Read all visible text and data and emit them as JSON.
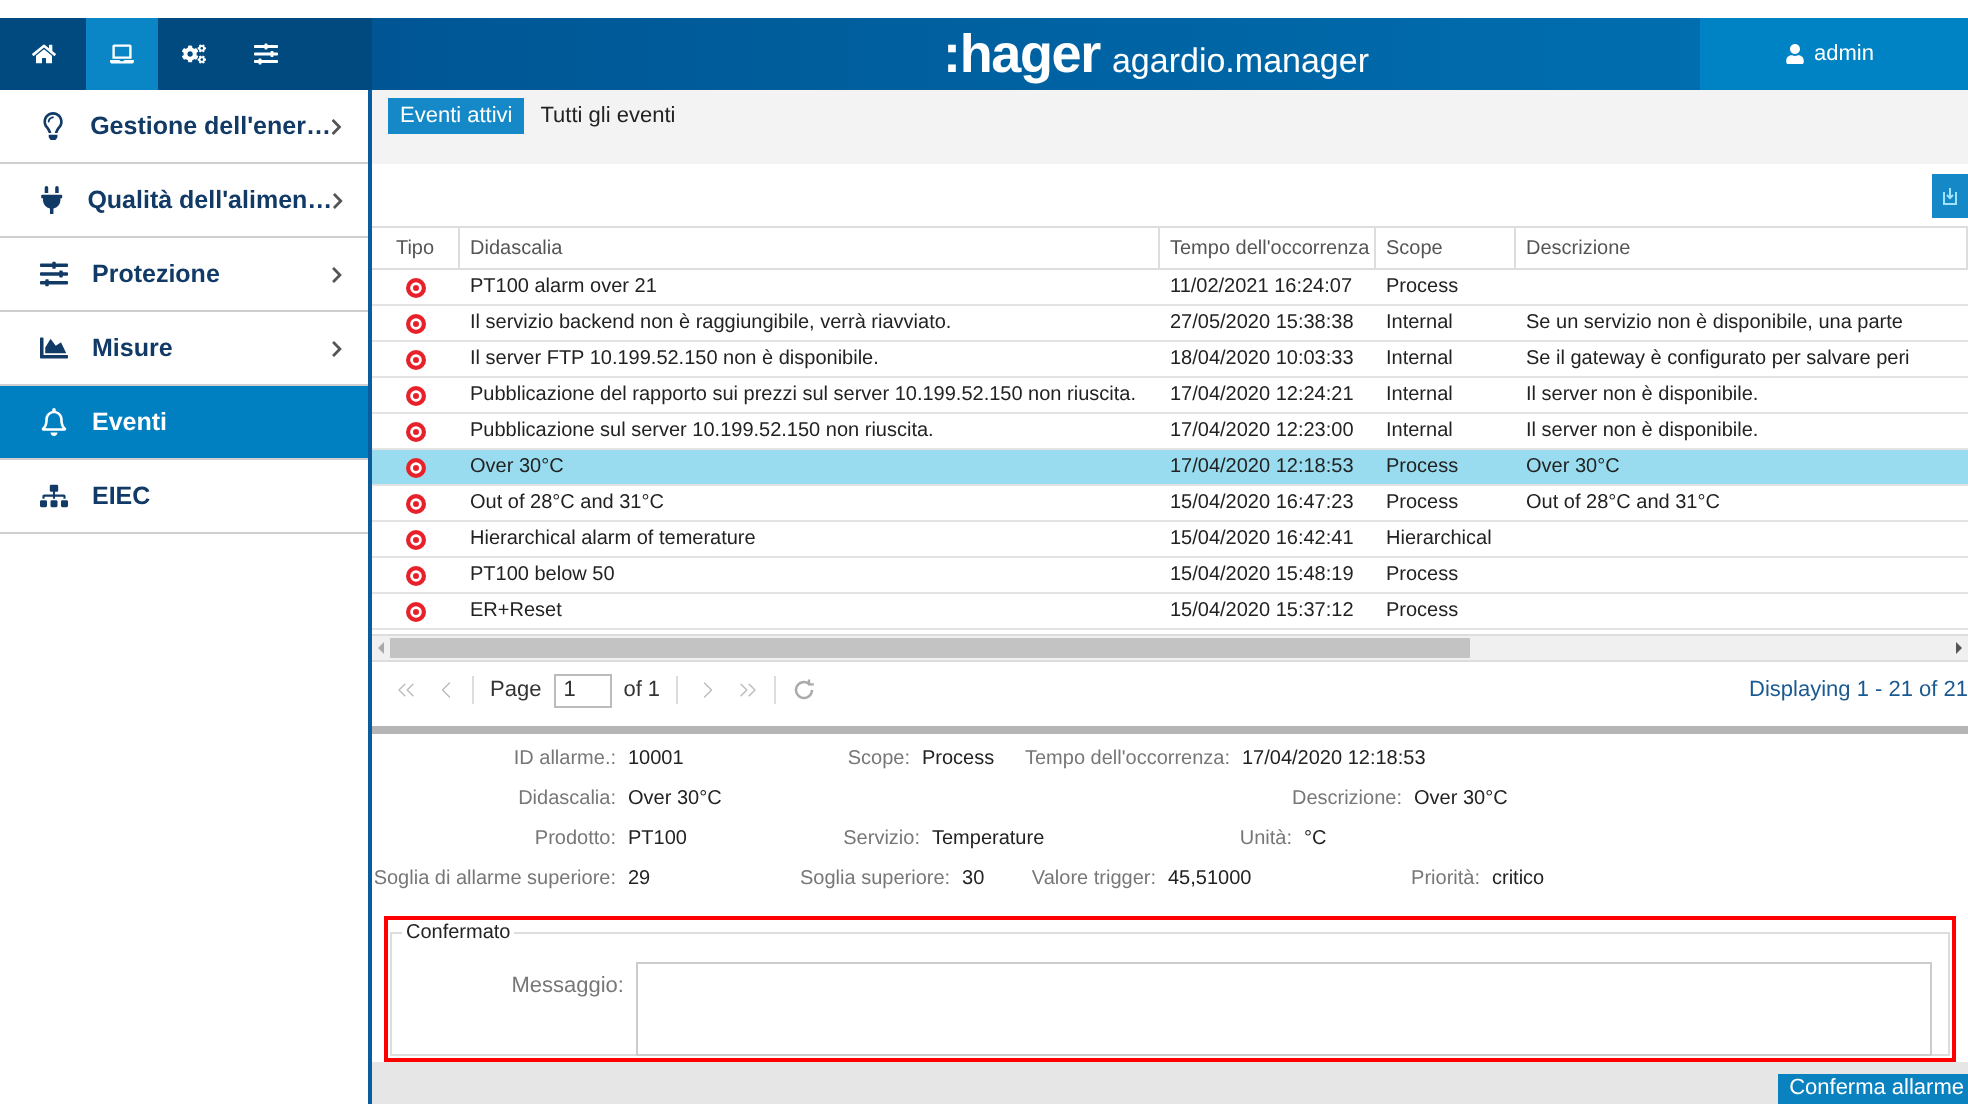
{
  "top_tabs": [
    {
      "selected": false
    },
    {
      "selected": true
    },
    {
      "selected": false
    },
    {
      "selected": false
    }
  ],
  "header": {
    "brand": ":hager",
    "product": "agardio.manager",
    "user": "admin"
  },
  "sidebar": {
    "items": [
      {
        "label": "Gestione dell'ener…",
        "selected": false,
        "has_submenu": true
      },
      {
        "label": "Qualità dell'alimen…",
        "selected": false,
        "has_submenu": true
      },
      {
        "label": "Protezione",
        "selected": false,
        "has_submenu": true
      },
      {
        "label": "Misure",
        "selected": false,
        "has_submenu": true
      },
      {
        "label": "Eventi",
        "selected": true,
        "has_submenu": false
      },
      {
        "label": "EIEC",
        "selected": false,
        "has_submenu": false
      }
    ]
  },
  "tabs": [
    {
      "label": "Eventi attivi",
      "selected": true
    },
    {
      "label": "Tutti gli eventi",
      "selected": false
    }
  ],
  "table": {
    "columns": [
      "Tipo",
      "Didascalia",
      "Tempo dell'occorrenza",
      "Scope",
      "Descrizione"
    ],
    "rows": [
      {
        "caption": "PT100 alarm over 21",
        "time": "11/02/2021 16:24:07",
        "scope": "Process",
        "description": "",
        "selected": false
      },
      {
        "caption": "Il servizio backend non è raggiungibile, verrà riavviato.",
        "time": "27/05/2020 15:38:38",
        "scope": "Internal",
        "description": "Se un servizio non è disponibile, una parte",
        "selected": false
      },
      {
        "caption": "Il server FTP 10.199.52.150 non è disponibile.",
        "time": "18/04/2020 10:03:33",
        "scope": "Internal",
        "description": "Se il gateway è configurato per salvare peri",
        "selected": false
      },
      {
        "caption": "Pubblicazione del rapporto sui prezzi sul server 10.199.52.150 non riuscita.",
        "time": "17/04/2020 12:24:21",
        "scope": "Internal",
        "description": "Il server non è disponibile.",
        "selected": false
      },
      {
        "caption": "Pubblicazione sul server 10.199.52.150 non riuscita.",
        "time": "17/04/2020 12:23:00",
        "scope": "Internal",
        "description": "Il server non è disponibile.",
        "selected": false
      },
      {
        "caption": "Over 30°C",
        "time": "17/04/2020 12:18:53",
        "scope": "Process",
        "description": "Over 30°C",
        "selected": true
      },
      {
        "caption": "Out of 28°C and 31°C",
        "time": "15/04/2020 16:47:23",
        "scope": "Process",
        "description": "Out of 28°C and 31°C",
        "selected": false
      },
      {
        "caption": "Hierarchical alarm of temerature",
        "time": "15/04/2020 16:42:41",
        "scope": "Hierarchical",
        "description": "",
        "selected": false
      },
      {
        "caption": "PT100 below 50",
        "time": "15/04/2020 15:48:19",
        "scope": "Process",
        "description": "",
        "selected": false
      },
      {
        "caption": "ER+Reset",
        "time": "15/04/2020 15:37:12",
        "scope": "Process",
        "description": "",
        "selected": false
      }
    ]
  },
  "pager": {
    "page_label": "Page",
    "page": "1",
    "of": "of 1",
    "summary": "Displaying 1 - 21 of 21"
  },
  "details": {
    "fields": [
      {
        "label": "ID allarme.:",
        "value": "10001"
      },
      {
        "label": "Scope:",
        "value": "Process"
      },
      {
        "label": "Tempo dell'occorrenza:",
        "value": "17/04/2020 12:18:53"
      },
      {
        "label": "Didascalia:",
        "value": "Over 30°C"
      },
      {
        "label": "Descrizione:",
        "value": "Over 30°C"
      },
      {
        "label": "Prodotto:",
        "value": "PT100"
      },
      {
        "label": "Servizio:",
        "value": "Temperature"
      },
      {
        "label": "Unità:",
        "value": "°C"
      },
      {
        "label": "Soglia di allarme superiore:",
        "value": "29"
      },
      {
        "label": "Soglia superiore:",
        "value": "30"
      },
      {
        "label": "Valore trigger:",
        "value": "45,51000"
      },
      {
        "label": "Priorità:",
        "value": "critico"
      }
    ]
  },
  "acknowledge": {
    "legend": "Confermato",
    "message_label": "Messaggio:",
    "button": "Conferma allarme"
  }
}
